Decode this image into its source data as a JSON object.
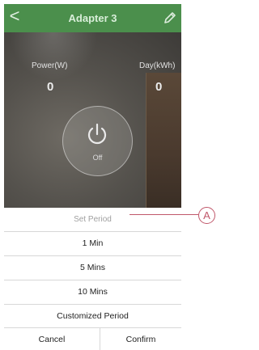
{
  "header": {
    "back_glyph": "<",
    "title": "Adapter 3",
    "edit_icon": "pencil-icon"
  },
  "device": {
    "power_label": "Power(W)",
    "power_value": "0",
    "day_label": "Day(kWh)",
    "day_value": "0",
    "switch_state": "Off"
  },
  "period_sheet": {
    "title": "Set Period",
    "options": [
      "1 Min",
      "5 Mins",
      "10 Mins",
      "Customized Period"
    ],
    "cancel_label": "Cancel",
    "confirm_label": "Confirm"
  },
  "annotation": {
    "badge": "A"
  },
  "colors": {
    "header_green": "#4b8f4c",
    "callout": "#c0576a",
    "divider": "#d7d7d7"
  }
}
